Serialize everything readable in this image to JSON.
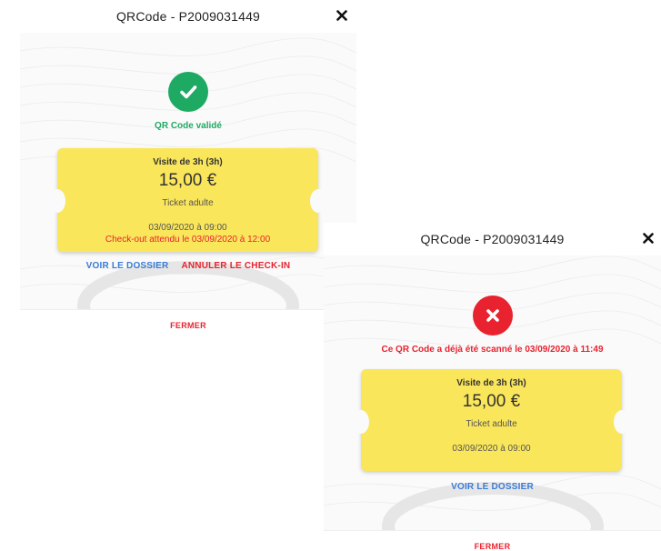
{
  "colors": {
    "success": "#1faa63",
    "error": "#e8232f",
    "ticket": "#fae65a",
    "link": "#3a7bd5"
  },
  "dialog_success": {
    "title": "QRCode - P2009031449",
    "close_icon": "close-icon",
    "status_icon": "check-icon",
    "status_text": "QR Code validé",
    "ticket": {
      "title": "Visite de 3h (3h)",
      "price": "15,00 €",
      "type": "Ticket adulte",
      "date": "03/09/2020 à 09:00",
      "checkout": "Check-out attendu le 03/09/2020 à 12:00"
    },
    "view_file_label": "VOIR LE DOSSIER",
    "cancel_checkin_label": "ANNULER LE CHECK-IN",
    "close_label": "FERMER"
  },
  "dialog_error": {
    "title": "QRCode - P2009031449",
    "close_icon": "close-icon",
    "status_icon": "x-icon",
    "status_text": "Ce QR Code a déjà été scanné le 03/09/2020 à 11:49",
    "ticket": {
      "title": "Visite de 3h (3h)",
      "price": "15,00 €",
      "type": "Ticket adulte",
      "date": "03/09/2020 à 09:00"
    },
    "view_file_label": "VOIR LE DOSSIER",
    "close_label": "FERMER"
  }
}
